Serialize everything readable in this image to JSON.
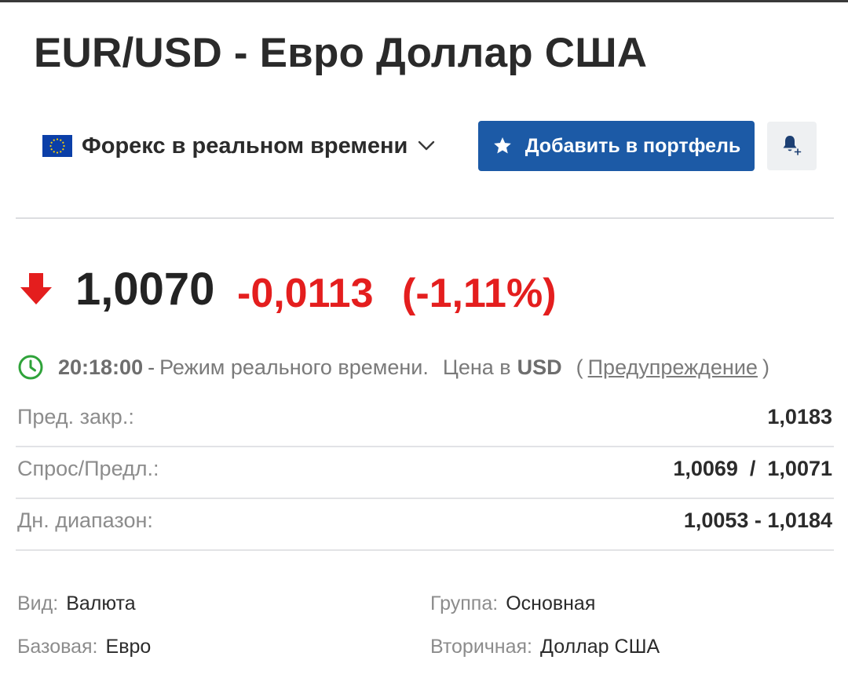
{
  "header": {
    "title": "EUR/USD - Евро Доллар США"
  },
  "market_selector": {
    "flag_icon": "eu-flag-icon",
    "label": "Форекс в реальном времени"
  },
  "actions": {
    "add_to_portfolio_label": "Добавить в портфель",
    "accent_color": "#1c5aa6"
  },
  "quote": {
    "last_price": "1,0070",
    "change": "-0,0113",
    "change_percent": "(-1,11%)",
    "direction": "down",
    "negative_color": "#e41e1e"
  },
  "status": {
    "time": "20:18:00",
    "separator": "-",
    "mode_text": "Режим реального времени.",
    "currency_label": "Цена в",
    "currency_code": "USD",
    "paren_open": "(",
    "warning_link": "Предупреждение",
    "paren_close": ")"
  },
  "stats": [
    {
      "label": "Пред. закр.:",
      "value": "1,0183"
    },
    {
      "label": "Спрос/Предл.:",
      "value": "1,0069  /  1,0071"
    },
    {
      "label": "Дн. диапазон:",
      "value": "1,0053 - 1,0184"
    }
  ],
  "info": {
    "type_label": "Вид:",
    "type_value": "Валюта",
    "group_label": "Группа:",
    "group_value": "Основная",
    "base_label": "Базовая:",
    "base_value": "Евро",
    "secondary_label": "Вторичная:",
    "secondary_value": "Доллар США"
  }
}
